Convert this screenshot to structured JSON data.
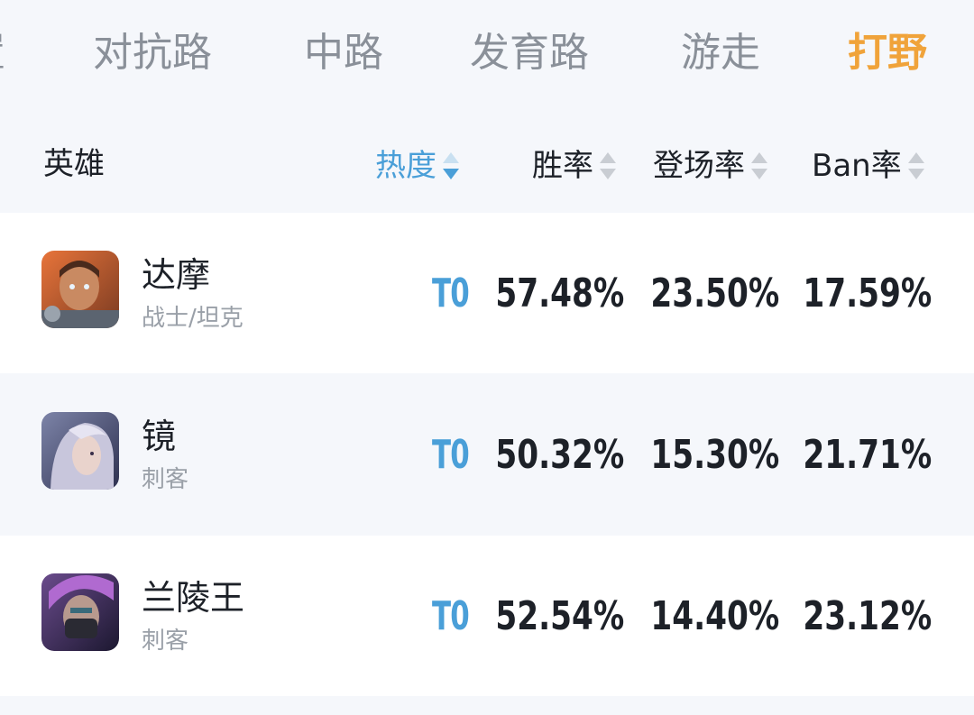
{
  "tabs": [
    {
      "label": "置"
    },
    {
      "label": "对抗路"
    },
    {
      "label": "中路"
    },
    {
      "label": "发育路"
    },
    {
      "label": "游走"
    },
    {
      "label": "打野",
      "active": true
    }
  ],
  "header": {
    "hero": "英雄",
    "heat": "热度",
    "win_rate": "胜率",
    "pick_rate": "登场率",
    "ban_rate": "Ban率"
  },
  "colors": {
    "active_tab": "#f0a33a",
    "accent_blue": "#4a9fd8",
    "text_dark": "#1d2128",
    "text_gray": "#9aa0a8"
  },
  "rows": [
    {
      "name": "达摩",
      "role": "战士/坦克",
      "tier": "T0",
      "win_rate": "57.48%",
      "pick_rate": "23.50%",
      "ban_rate": "17.59%",
      "avatar_icon": "hero-portrait-icon"
    },
    {
      "name": "镜",
      "role": "刺客",
      "tier": "T0",
      "win_rate": "50.32%",
      "pick_rate": "15.30%",
      "ban_rate": "21.71%",
      "avatar_icon": "hero-portrait-icon"
    },
    {
      "name": "兰陵王",
      "role": "刺客",
      "tier": "T0",
      "win_rate": "52.54%",
      "pick_rate": "14.40%",
      "ban_rate": "23.12%",
      "avatar_icon": "hero-portrait-icon"
    }
  ]
}
